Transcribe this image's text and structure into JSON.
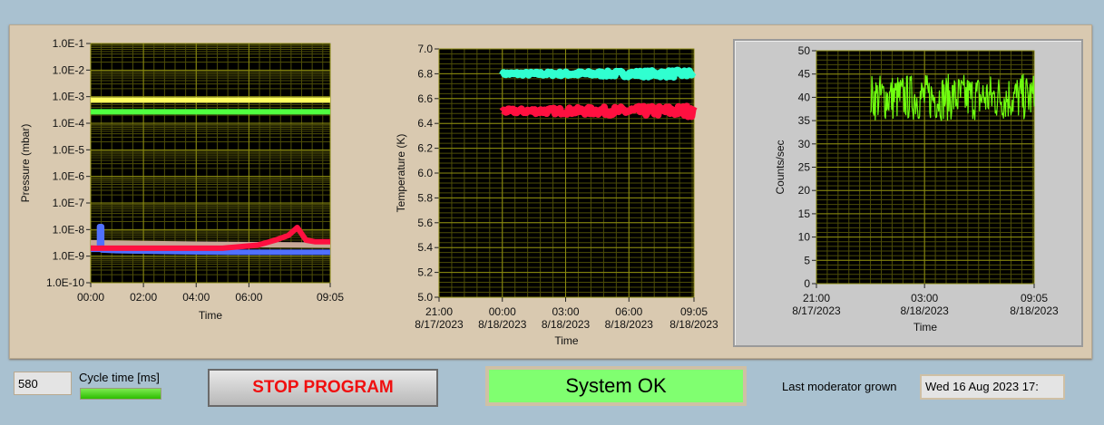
{
  "controls": {
    "cycle_value": "580",
    "cycle_label": "Cycle time [ms]",
    "stop_label": "STOP PROGRAM",
    "status_text": "System OK",
    "last_moderator_label": "Last moderator grown",
    "last_moderator_value": "Wed 16 Aug 2023 17:"
  },
  "colors": {
    "panel": "#d9c9b0",
    "plot_bg": "#000000",
    "grid_major": "#8c8c10",
    "grid_minor": "#4d4d08",
    "status_ok": "#80ff70"
  },
  "chart_data": [
    {
      "type": "line",
      "title": "",
      "xlabel": "Time",
      "ylabel": "Pressure (mbar)",
      "yscale": "log",
      "ylim": [
        1e-10,
        0.1
      ],
      "xlim_minutes": [
        0,
        545
      ],
      "yticks": [
        "1.0E-10",
        "1.0E-9",
        "1.0E-8",
        "1.0E-7",
        "1.0E-6",
        "1.0E-5",
        "1.0E-4",
        "1.0E-3",
        "1.0E-2",
        "1.0E-1"
      ],
      "xticks": [
        {
          "m": 0,
          "label": "00:00"
        },
        {
          "m": 120,
          "label": "02:00"
        },
        {
          "m": 240,
          "label": "04:00"
        },
        {
          "m": 360,
          "label": "06:00"
        },
        {
          "m": 545,
          "label": "09:05"
        }
      ],
      "series": [
        {
          "name": "yellow",
          "color": "#ffff60",
          "x": [
            0,
            545
          ],
          "y": [
            0.00075,
            0.00075
          ]
        },
        {
          "name": "green",
          "color": "#50ff40",
          "x": [
            0,
            545
          ],
          "y": [
            0.00027,
            0.00027
          ]
        },
        {
          "name": "tan",
          "color": "#c8a898",
          "x": [
            0,
            100,
            250,
            545
          ],
          "y": [
            3.2e-09,
            3e-09,
            2.8e-09,
            2.6e-09
          ]
        },
        {
          "name": "blue",
          "color": "#5070ff",
          "x": [
            0,
            20,
            20,
            25,
            25,
            60,
            160,
            220,
            320,
            545
          ],
          "y": [
            1.8e-09,
            1.8e-09,
            1.3e-08,
            1.3e-08,
            1.7e-09,
            1.6e-09,
            1.5e-09,
            1.45e-09,
            1.4e-09,
            1.4e-09
          ]
        },
        {
          "name": "red",
          "color": "#ff1040",
          "x": [
            0,
            300,
            380,
            420,
            450,
            470,
            490,
            510,
            545
          ],
          "y": [
            2e-09,
            2e-09,
            2.6e-09,
            4e-09,
            6e-09,
            1.2e-08,
            4e-09,
            3.5e-09,
            3.5e-09
          ]
        }
      ]
    },
    {
      "type": "line",
      "title": "",
      "xlabel": "Time",
      "ylabel": "Temperature (K)",
      "ylim": [
        5.0,
        7.0
      ],
      "xlim_minutes": [
        -180,
        545
      ],
      "yticks": [
        "5.0",
        "5.2",
        "5.4",
        "5.6",
        "5.8",
        "6.0",
        "6.2",
        "6.4",
        "6.6",
        "6.8",
        "7.0"
      ],
      "xticks": [
        {
          "m": -180,
          "label": "21:00",
          "date": "8/17/2023"
        },
        {
          "m": 0,
          "label": "00:00",
          "date": "8/18/2023"
        },
        {
          "m": 180,
          "label": "03:00",
          "date": "8/18/2023"
        },
        {
          "m": 360,
          "label": "06:00",
          "date": "8/18/2023"
        },
        {
          "m": 545,
          "label": "09:05",
          "date": "8/18/2023"
        }
      ],
      "series": [
        {
          "name": "cyan",
          "color": "#30ffd0",
          "x": [
            0,
            545
          ],
          "y": [
            6.8,
            6.79
          ],
          "noise": 0.02
        },
        {
          "name": "red",
          "color": "#ff1040",
          "x": [
            0,
            545
          ],
          "y": [
            6.5,
            6.5
          ],
          "noise": 0.03
        }
      ]
    },
    {
      "type": "line",
      "title": "",
      "xlabel": "Time",
      "ylabel": "Counts/sec",
      "ylim": [
        0,
        50
      ],
      "xlim_minutes": [
        -180,
        545
      ],
      "yticks": [
        "0",
        "5",
        "10",
        "15",
        "20",
        "25",
        "30",
        "35",
        "40",
        "45",
        "50"
      ],
      "xticks": [
        {
          "m": -180,
          "label": "21:00",
          "date": "8/17/2023"
        },
        {
          "m": 180,
          "label": "03:00",
          "date": "8/18/2023"
        },
        {
          "m": 545,
          "label": "09:05",
          "date": "8/18/2023"
        }
      ],
      "series": [
        {
          "name": "counts",
          "color": "#70ff10",
          "x": [
            0,
            545
          ],
          "y": [
            40,
            40
          ],
          "noise": 5
        }
      ]
    }
  ]
}
